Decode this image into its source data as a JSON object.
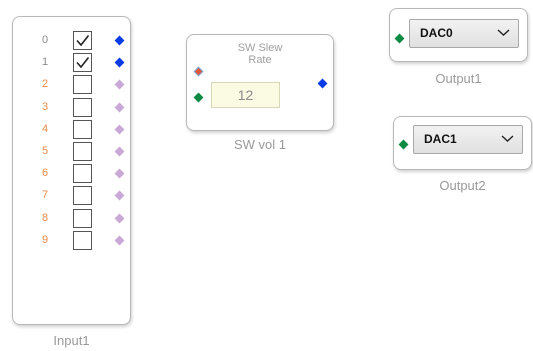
{
  "colors": {
    "pin_blue": "#0a3ce6",
    "pin_green": "#0e8a43",
    "pin_red": "#e2543a",
    "pin_lilac": "#c9a8d8",
    "index_active": "#8a8a8a",
    "index_inactive": "#e98b4a"
  },
  "input_block": {
    "caption": "Input1",
    "rows": [
      {
        "index": "0",
        "checked": true,
        "pin": "blue-diamond-icon"
      },
      {
        "index": "1",
        "checked": true,
        "pin": "blue-diamond-icon"
      },
      {
        "index": "2",
        "checked": false,
        "pin": "lilac-diamond-icon"
      },
      {
        "index": "3",
        "checked": false,
        "pin": "lilac-diamond-icon"
      },
      {
        "index": "4",
        "checked": false,
        "pin": "lilac-diamond-icon"
      },
      {
        "index": "5",
        "checked": false,
        "pin": "lilac-diamond-icon"
      },
      {
        "index": "6",
        "checked": false,
        "pin": "lilac-diamond-icon"
      },
      {
        "index": "7",
        "checked": false,
        "pin": "lilac-diamond-icon"
      },
      {
        "index": "8",
        "checked": false,
        "pin": "lilac-diamond-icon"
      },
      {
        "index": "9",
        "checked": false,
        "pin": "lilac-diamond-icon"
      }
    ]
  },
  "slew_block": {
    "title_line1": "SW Slew",
    "title_line2": "Rate",
    "value": "12",
    "caption": "SW vol 1"
  },
  "output1": {
    "selected": "DAC0",
    "caption": "Output1"
  },
  "output2": {
    "selected": "DAC1",
    "caption": "Output2"
  }
}
